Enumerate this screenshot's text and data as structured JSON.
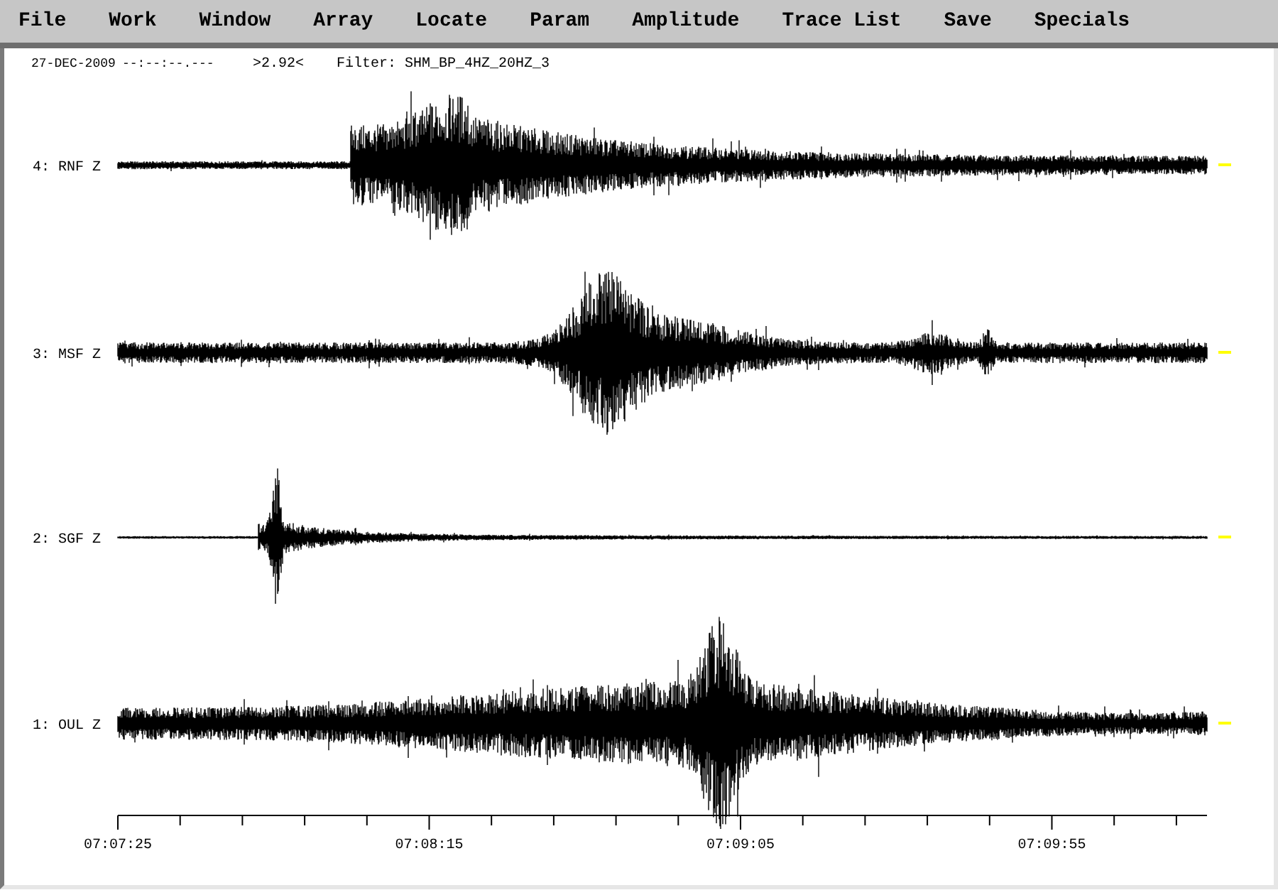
{
  "menu": [
    {
      "label": "File"
    },
    {
      "label": "Work"
    },
    {
      "label": "Window"
    },
    {
      "label": "Array"
    },
    {
      "label": "Locate"
    },
    {
      "label": "Param"
    },
    {
      "label": "Amplitude"
    },
    {
      "label": "Trace List"
    },
    {
      "label": "Save"
    },
    {
      "label": "Specials"
    }
  ],
  "header": {
    "date": "27-DEC-2009",
    "time": "--:--:--.---",
    "ratio": ">2.92<",
    "filter": "Filter: SHM_BP_4HZ_20HZ_3"
  },
  "traces": [
    {
      "label": "4: RNF Z"
    },
    {
      "label": "3: MSF Z"
    },
    {
      "label": "2: SGF Z"
    },
    {
      "label": "1: OUL Z"
    }
  ],
  "time_axis": {
    "labels": [
      "07:07:25",
      "07:08:15",
      "07:09:05",
      "07:09:55"
    ]
  }
}
